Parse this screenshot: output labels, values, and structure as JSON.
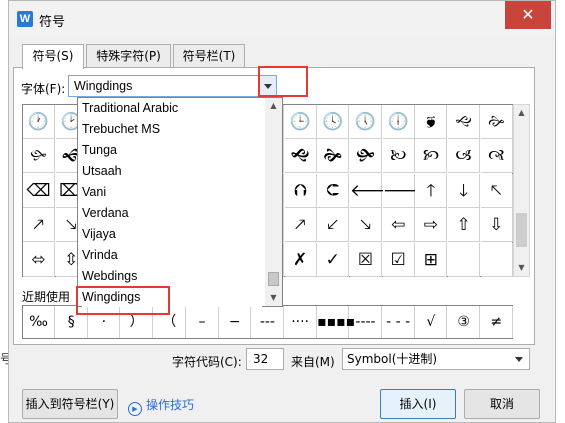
{
  "window": {
    "title": "符号",
    "app_icon_letter": "W",
    "close_glyph": "✕"
  },
  "backdrop": {
    "left_glyph": "号"
  },
  "tabs": [
    {
      "label": "符号(S)",
      "active": true
    },
    {
      "label": "特殊字符(P)",
      "active": false
    },
    {
      "label": "符号栏(T)",
      "active": false
    }
  ],
  "font": {
    "label": "字体(F):",
    "value": "Wingdings"
  },
  "dropdown": {
    "items": [
      "Traditional Arabic",
      "Trebuchet MS",
      "Tunga",
      "Utsaah",
      "Vani",
      "Verdana",
      "Vijaya",
      "Vrinda",
      "Webdings",
      "Wingdings"
    ],
    "selected": "Wingdings"
  },
  "grid": {
    "rows": [
      [
        "🕐",
        "🕑",
        "",
        "",
        "",
        "",
        "",
        "",
        "🕒",
        "🕓",
        "🕔",
        "🕕",
        "🙘",
        "🙙",
        "🙚"
      ],
      [
        "🙛",
        "🙜",
        "",
        "",
        "",
        "",
        "",
        "",
        "🙝",
        "🙞",
        "🙟",
        "🙠",
        "🙡",
        "🙢",
        "🙣"
      ],
      [
        "⌫",
        "⌦",
        "",
        "",
        "",
        "",
        "",
        "",
        "⮉",
        "⮈",
        "🡐",
        "🡒",
        "🡑",
        "🡓",
        "🡔"
      ],
      [
        "🡕",
        "🡖",
        "",
        "",
        "",
        "",
        "",
        "",
        "🡕",
        "🡗",
        "🡖",
        "⇦",
        "⇨",
        "⇧",
        "⇩"
      ],
      [
        "⬄",
        "⇳",
        "",
        "",
        "",
        "",
        "",
        "",
        "✗",
        "✓",
        "☒",
        "☑",
        "⊞",
        "",
        ""
      ]
    ]
  },
  "recent": {
    "label": "近期使用",
    "symbols": [
      "‰",
      "§",
      "·",
      "）",
      "（",
      "–",
      "−",
      "---",
      "····",
      "▪▪▪▪",
      "----",
      "- - -",
      "√",
      "③",
      "≠"
    ]
  },
  "code": {
    "label": "字符代码(C):",
    "value": "32",
    "from_label": "来自(M)",
    "from_value": "Symbol(十进制)"
  },
  "buttons": {
    "insert_to_bar": "插入到符号栏(Y)",
    "tips": "操作技巧",
    "insert": "插入(I)",
    "cancel": "取消"
  },
  "colors": {
    "highlight": "#e53935",
    "accent": "#2a6ed8",
    "close": "#c9453b"
  }
}
